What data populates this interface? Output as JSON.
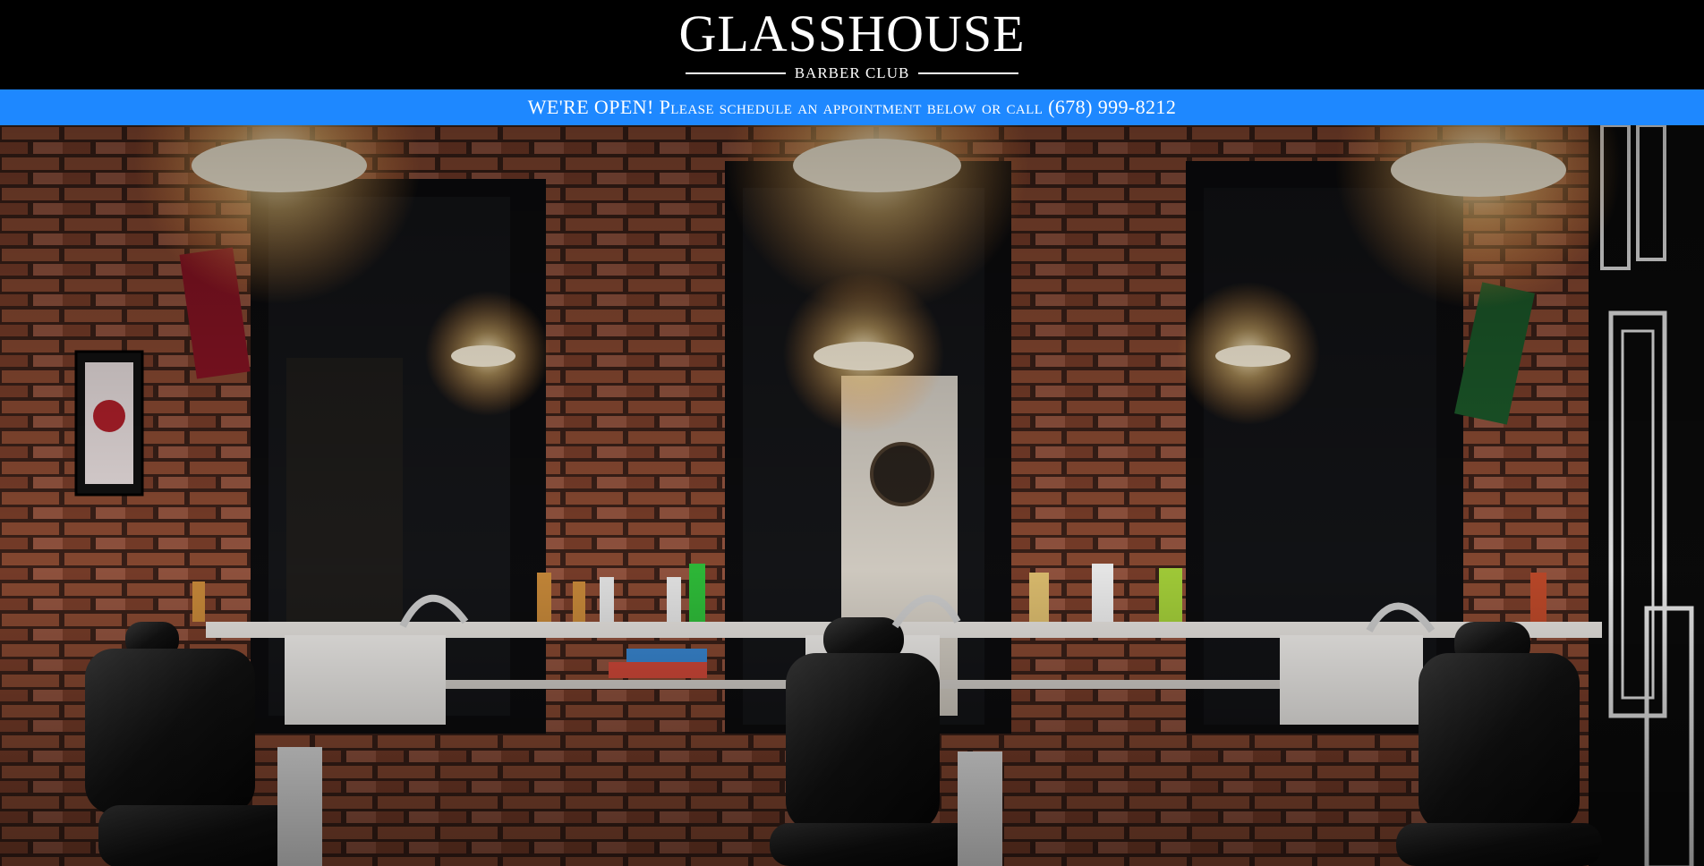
{
  "header": {
    "logo_title": "GLASSHOUSE",
    "logo_subtitle": "BARBER CLUB"
  },
  "banner": {
    "text": "WE'RE OPEN! Please schedule an appointment below or call (678) 999-8212"
  },
  "hero": {
    "image_description_icon": "barbershop-photo"
  },
  "colors": {
    "header_bg": "#000000",
    "banner_bg": "#1e88ff",
    "text": "#ffffff",
    "brick": "#8a4a32",
    "leather": "#141414"
  }
}
